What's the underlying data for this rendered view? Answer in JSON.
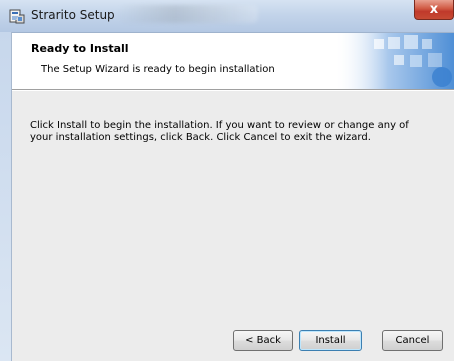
{
  "window": {
    "title": "Strarito Setup",
    "close_glyph": "x"
  },
  "header": {
    "title": "Ready to Install",
    "subtitle": "The Setup Wizard is ready to begin installation"
  },
  "body": {
    "text": "Click Install to begin the installation.  If you want to review or change any of your installation settings, click Back.  Click Cancel to exit the wizard."
  },
  "buttons": {
    "back": "< Back",
    "install": "Install",
    "cancel": "Cancel"
  },
  "icons": {
    "app": "installer-icon",
    "close": "close-icon",
    "banner": "banner-graphic"
  },
  "colors": {
    "titlebar": "#c3d4ea",
    "close": "#c0392b",
    "dialog_bg": "#ececec",
    "default_button_border": "#3c7fb1"
  }
}
